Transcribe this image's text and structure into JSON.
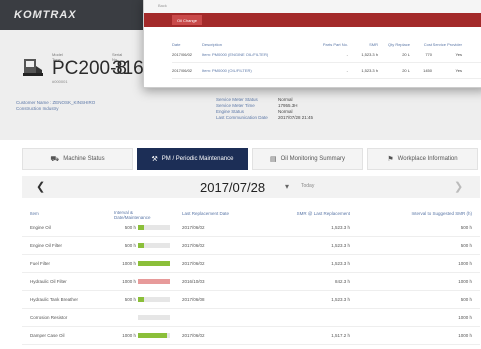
{
  "header": {
    "brand": "KOMTRAX"
  },
  "machine": {
    "model_label": "Model Type",
    "model": "PC200-8",
    "serial_label": "Serial No.",
    "serial": "31601",
    "sub": "#000001"
  },
  "info_left": [
    "Customer Name : ZENOSK_KINSHIRO",
    "Construction Industry"
  ],
  "info_right": [
    {
      "k": "Service Meter Status",
      "v": "Normal"
    },
    {
      "k": "Service Meter Time",
      "v": "17955.3H"
    },
    {
      "k": "Engine Status",
      "v": "Normal"
    },
    {
      "k": "Last Communication Date",
      "v": "2017/07/28 21:45"
    }
  ],
  "tabs": [
    {
      "label": "Machine Status",
      "icon": "truck-icon"
    },
    {
      "label": "PM / Periodic Maintenance",
      "icon": "wrench-icon"
    },
    {
      "label": "Oil Monitoring Summary",
      "icon": "chart-icon"
    },
    {
      "label": "Workplace Information",
      "icon": "pin-icon"
    }
  ],
  "active_tab": 1,
  "date_bar": {
    "prev": "❮",
    "date": "2017/07/28",
    "caret": "▾",
    "today": "Today",
    "next": "❯"
  },
  "table": {
    "headers": [
      "Item",
      "Interval & Date/Maintenance",
      "Last Replacement Date",
      "SMR @ Last Replacement",
      "Interval to Suggested SMR (h)"
    ],
    "rows": [
      {
        "item": "Engine Oil",
        "remain": "500 h",
        "pct": 20,
        "color": "#8bbf3a",
        "date": "2017/06/02",
        "smr": "1,523.3 h",
        "interval": "500 h"
      },
      {
        "item": "Engine Oil Filter",
        "remain": "500 h",
        "pct": 20,
        "color": "#8bbf3a",
        "date": "2017/06/02",
        "smr": "1,523.3 h",
        "interval": "500 h"
      },
      {
        "item": "Fuel Filter",
        "remain": "1000 h",
        "pct": 100,
        "color": "#8bbf3a",
        "date": "2017/06/02",
        "smr": "1,523.3 h",
        "interval": "1000 h"
      },
      {
        "item": "Hydraulic Oil Filter",
        "remain": "1000 h",
        "pct": 100,
        "color": "#e79a9a",
        "date": "2016/10/03",
        "smr": "842.3 h",
        "interval": "1000 h"
      },
      {
        "item": "Hydraulic Tank Breather",
        "remain": "500 h",
        "pct": 20,
        "color": "#8bbf3a",
        "date": "2017/06/08",
        "smr": "1,523.3 h",
        "interval": "500 h"
      },
      {
        "item": "Corrosion Resistor",
        "remain": "",
        "pct": 0,
        "color": "#8bbf3a",
        "date": "",
        "smr": "",
        "interval": "1000 h"
      },
      {
        "item": "Damper Case Oil",
        "remain": "1000 h",
        "pct": 90,
        "color": "#8bbf3a",
        "date": "2017/06/02",
        "smr": "1,517.2 h",
        "interval": "1000 h"
      }
    ]
  },
  "popup": {
    "head_label": "Back",
    "tag": "Oil Change",
    "headers": [
      "Date",
      "Description",
      "Parts Part No.",
      "SMR",
      "Qty Replace",
      "Cost",
      "Service Provider"
    ],
    "rows": [
      {
        "date": "2017/06/02",
        "desc": "Item: PM0000 (ENGINE OIL/FILTER)",
        "part": "-",
        "smr": "1,523.3 h",
        "qty": "20 L",
        "cost": "770",
        "prov": "Yes"
      },
      {
        "date": "2017/06/02",
        "desc": "Item: PM0000 (OIL/FILTER)",
        "part": "-",
        "smr": "1,523.3 h",
        "qty": "20 L",
        "cost": "1450",
        "prov": "Yes"
      }
    ]
  }
}
